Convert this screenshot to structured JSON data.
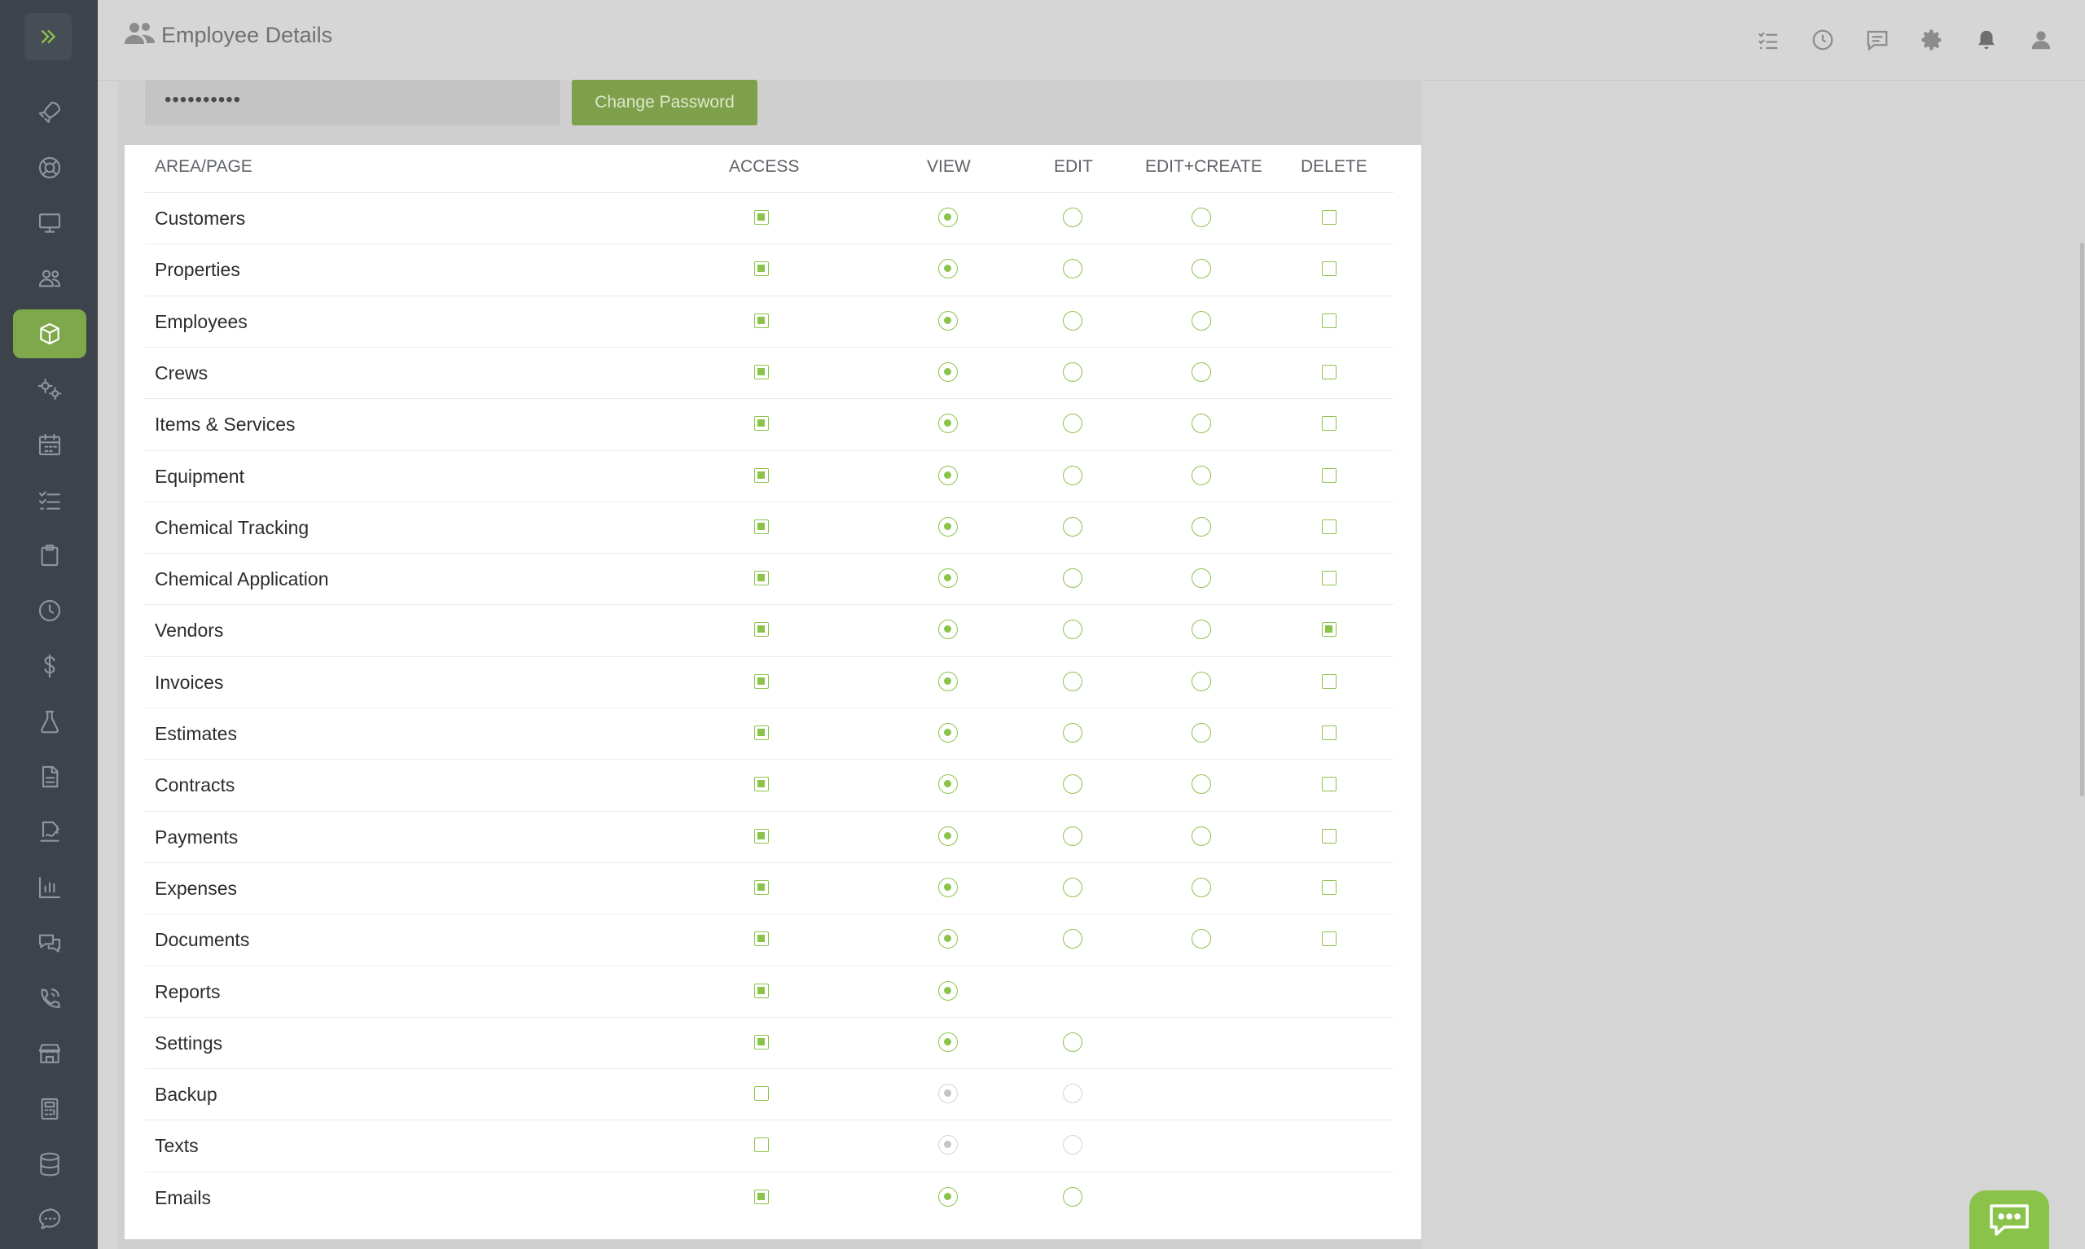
{
  "header": {
    "title": "Employee Details"
  },
  "password": {
    "masked_value": "••••••••••",
    "change_button": "Change Password"
  },
  "permissions": {
    "columns": {
      "area": "AREA/PAGE",
      "access": "ACCESS",
      "view": "VIEW",
      "edit": "EDIT",
      "edit_create": "EDIT+CREATE",
      "delete": "DELETE"
    },
    "rows": [
      {
        "label": "Customers",
        "access": true,
        "view": true,
        "edit": false,
        "edit_create": false,
        "delete": false
      },
      {
        "label": "Properties",
        "access": true,
        "view": true,
        "edit": false,
        "edit_create": false,
        "delete": false
      },
      {
        "label": "Employees",
        "access": true,
        "view": true,
        "edit": false,
        "edit_create": false,
        "delete": false
      },
      {
        "label": "Crews",
        "access": true,
        "view": true,
        "edit": false,
        "edit_create": false,
        "delete": false
      },
      {
        "label": "Items & Services",
        "access": true,
        "view": true,
        "edit": false,
        "edit_create": false,
        "delete": false
      },
      {
        "label": "Equipment",
        "access": true,
        "view": true,
        "edit": false,
        "edit_create": false,
        "delete": false
      },
      {
        "label": "Chemical Tracking",
        "access": true,
        "view": true,
        "edit": false,
        "edit_create": false,
        "delete": false
      },
      {
        "label": "Chemical Application",
        "access": true,
        "view": true,
        "edit": false,
        "edit_create": false,
        "delete": false
      },
      {
        "label": "Vendors",
        "access": true,
        "view": true,
        "edit": false,
        "edit_create": false,
        "delete": true
      },
      {
        "label": "Invoices",
        "access": true,
        "view": true,
        "edit": false,
        "edit_create": false,
        "delete": false
      },
      {
        "label": "Estimates",
        "access": true,
        "view": true,
        "edit": false,
        "edit_create": false,
        "delete": false
      },
      {
        "label": "Contracts",
        "access": true,
        "view": true,
        "edit": false,
        "edit_create": false,
        "delete": false
      },
      {
        "label": "Payments",
        "access": true,
        "view": true,
        "edit": false,
        "edit_create": false,
        "delete": false
      },
      {
        "label": "Expenses",
        "access": true,
        "view": true,
        "edit": false,
        "edit_create": false,
        "delete": false
      },
      {
        "label": "Documents",
        "access": true,
        "view": true,
        "edit": false,
        "edit_create": false,
        "delete": false
      },
      {
        "label": "Reports",
        "access": true,
        "view": true
      },
      {
        "label": "Settings",
        "access": true,
        "view": true,
        "edit": false
      },
      {
        "label": "Backup",
        "access": false,
        "view": true,
        "edit": false,
        "disabled": true
      },
      {
        "label": "Texts",
        "access": false,
        "view": true,
        "edit": false,
        "disabled": true
      },
      {
        "label": "Emails",
        "access": true,
        "view": true,
        "edit": false
      }
    ]
  },
  "sidebar": {
    "icons": [
      "rocket-icon",
      "lifebuoy-icon",
      "monitor-icon",
      "users-icon",
      "box-icon",
      "gears-icon",
      "calendar-icon",
      "tasklist-icon",
      "clipboard-icon",
      "clock-icon",
      "dollar-icon",
      "flask-icon",
      "document-icon",
      "signature-icon",
      "chart-icon",
      "chat-icon",
      "phone-icon",
      "store-icon",
      "calculator-icon",
      "database-icon",
      "sms-icon"
    ],
    "active_index": 4
  },
  "header_icons": [
    "tasks-icon",
    "history-icon",
    "message-icon",
    "settings-icon",
    "bell-icon",
    "user-icon"
  ],
  "colors": {
    "accent": "#8bc34a",
    "sidebar_bg": "#3d434b"
  }
}
